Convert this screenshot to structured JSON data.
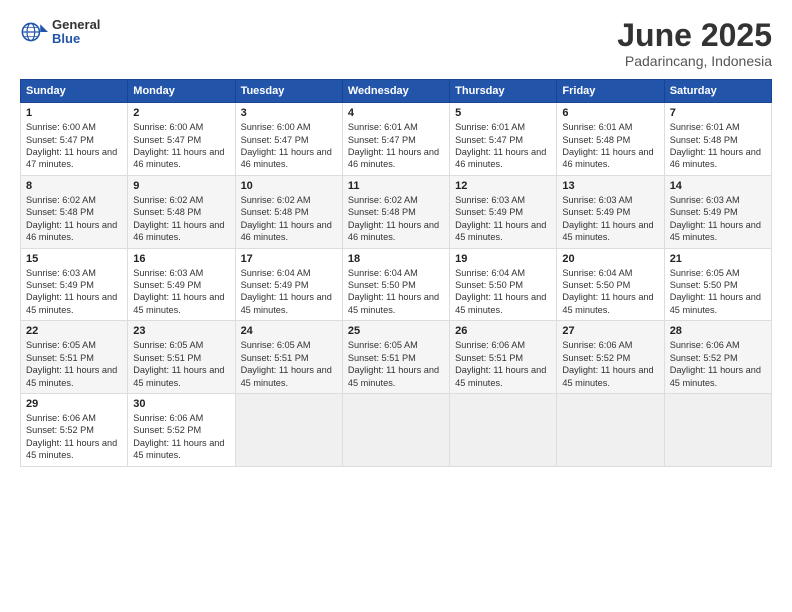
{
  "header": {
    "logo_general": "General",
    "logo_blue": "Blue",
    "title": "June 2025",
    "subtitle": "Padarincang, Indonesia"
  },
  "calendar": {
    "days_of_week": [
      "Sunday",
      "Monday",
      "Tuesday",
      "Wednesday",
      "Thursday",
      "Friday",
      "Saturday"
    ],
    "weeks": [
      [
        {
          "day": "1",
          "sunrise": "6:00 AM",
          "sunset": "5:47 PM",
          "daylight": "11 hours and 47 minutes."
        },
        {
          "day": "2",
          "sunrise": "6:00 AM",
          "sunset": "5:47 PM",
          "daylight": "11 hours and 46 minutes."
        },
        {
          "day": "3",
          "sunrise": "6:00 AM",
          "sunset": "5:47 PM",
          "daylight": "11 hours and 46 minutes."
        },
        {
          "day": "4",
          "sunrise": "6:01 AM",
          "sunset": "5:47 PM",
          "daylight": "11 hours and 46 minutes."
        },
        {
          "day": "5",
          "sunrise": "6:01 AM",
          "sunset": "5:47 PM",
          "daylight": "11 hours and 46 minutes."
        },
        {
          "day": "6",
          "sunrise": "6:01 AM",
          "sunset": "5:48 PM",
          "daylight": "11 hours and 46 minutes."
        },
        {
          "day": "7",
          "sunrise": "6:01 AM",
          "sunset": "5:48 PM",
          "daylight": "11 hours and 46 minutes."
        }
      ],
      [
        {
          "day": "8",
          "sunrise": "6:02 AM",
          "sunset": "5:48 PM",
          "daylight": "11 hours and 46 minutes."
        },
        {
          "day": "9",
          "sunrise": "6:02 AM",
          "sunset": "5:48 PM",
          "daylight": "11 hours and 46 minutes."
        },
        {
          "day": "10",
          "sunrise": "6:02 AM",
          "sunset": "5:48 PM",
          "daylight": "11 hours and 46 minutes."
        },
        {
          "day": "11",
          "sunrise": "6:02 AM",
          "sunset": "5:48 PM",
          "daylight": "11 hours and 46 minutes."
        },
        {
          "day": "12",
          "sunrise": "6:03 AM",
          "sunset": "5:49 PM",
          "daylight": "11 hours and 45 minutes."
        },
        {
          "day": "13",
          "sunrise": "6:03 AM",
          "sunset": "5:49 PM",
          "daylight": "11 hours and 45 minutes."
        },
        {
          "day": "14",
          "sunrise": "6:03 AM",
          "sunset": "5:49 PM",
          "daylight": "11 hours and 45 minutes."
        }
      ],
      [
        {
          "day": "15",
          "sunrise": "6:03 AM",
          "sunset": "5:49 PM",
          "daylight": "11 hours and 45 minutes."
        },
        {
          "day": "16",
          "sunrise": "6:03 AM",
          "sunset": "5:49 PM",
          "daylight": "11 hours and 45 minutes."
        },
        {
          "day": "17",
          "sunrise": "6:04 AM",
          "sunset": "5:49 PM",
          "daylight": "11 hours and 45 minutes."
        },
        {
          "day": "18",
          "sunrise": "6:04 AM",
          "sunset": "5:50 PM",
          "daylight": "11 hours and 45 minutes."
        },
        {
          "day": "19",
          "sunrise": "6:04 AM",
          "sunset": "5:50 PM",
          "daylight": "11 hours and 45 minutes."
        },
        {
          "day": "20",
          "sunrise": "6:04 AM",
          "sunset": "5:50 PM",
          "daylight": "11 hours and 45 minutes."
        },
        {
          "day": "21",
          "sunrise": "6:05 AM",
          "sunset": "5:50 PM",
          "daylight": "11 hours and 45 minutes."
        }
      ],
      [
        {
          "day": "22",
          "sunrise": "6:05 AM",
          "sunset": "5:51 PM",
          "daylight": "11 hours and 45 minutes."
        },
        {
          "day": "23",
          "sunrise": "6:05 AM",
          "sunset": "5:51 PM",
          "daylight": "11 hours and 45 minutes."
        },
        {
          "day": "24",
          "sunrise": "6:05 AM",
          "sunset": "5:51 PM",
          "daylight": "11 hours and 45 minutes."
        },
        {
          "day": "25",
          "sunrise": "6:05 AM",
          "sunset": "5:51 PM",
          "daylight": "11 hours and 45 minutes."
        },
        {
          "day": "26",
          "sunrise": "6:06 AM",
          "sunset": "5:51 PM",
          "daylight": "11 hours and 45 minutes."
        },
        {
          "day": "27",
          "sunrise": "6:06 AM",
          "sunset": "5:52 PM",
          "daylight": "11 hours and 45 minutes."
        },
        {
          "day": "28",
          "sunrise": "6:06 AM",
          "sunset": "5:52 PM",
          "daylight": "11 hours and 45 minutes."
        }
      ],
      [
        {
          "day": "29",
          "sunrise": "6:06 AM",
          "sunset": "5:52 PM",
          "daylight": "11 hours and 45 minutes."
        },
        {
          "day": "30",
          "sunrise": "6:06 AM",
          "sunset": "5:52 PM",
          "daylight": "11 hours and 45 minutes."
        },
        null,
        null,
        null,
        null,
        null
      ]
    ]
  },
  "labels": {
    "sunrise": "Sunrise:",
    "sunset": "Sunset:",
    "daylight": "Daylight:"
  }
}
